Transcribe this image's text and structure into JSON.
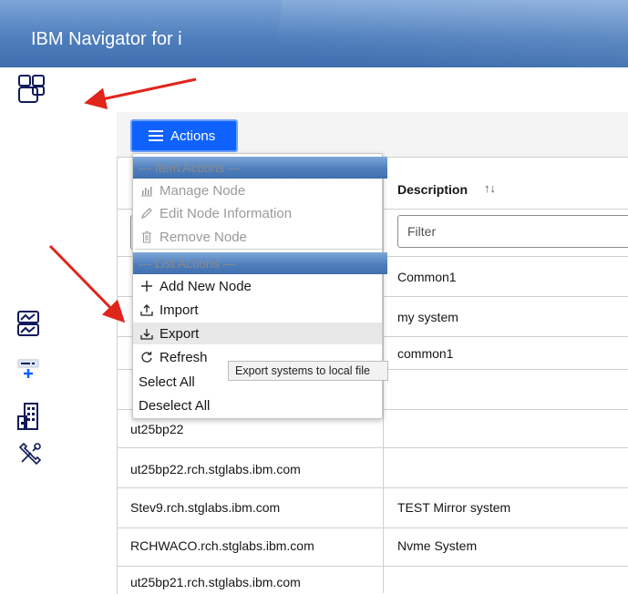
{
  "app": {
    "title": "IBM Navigator for i"
  },
  "toolbar": {
    "actions_label": "Actions"
  },
  "menu": {
    "item_actions_header": "--- Item Actions ---",
    "manage_node": "Manage Node",
    "edit_node_information": "Edit Node Information",
    "remove_node": "Remove Node",
    "list_actions_header": "--- List Actions ---",
    "add_new_node": "Add New Node",
    "import": "Import",
    "export": "Export",
    "refresh": "Refresh",
    "select_all": "Select All",
    "deselect_all": "Deselect All"
  },
  "tooltip": {
    "export": "Export systems to local file"
  },
  "table": {
    "description_header": "Description",
    "filter_placeholder": "Filter",
    "rows": [
      {
        "name": "",
        "description": "Common1"
      },
      {
        "name": "",
        "description": "my system"
      },
      {
        "name": "",
        "description": "common1"
      },
      {
        "name": "",
        "description": ""
      },
      {
        "name": "ut25bp22",
        "description": ""
      },
      {
        "name": "ut25bp22.rch.stglabs.ibm.com",
        "description": ""
      },
      {
        "name": "Stev9.rch.stglabs.ibm.com",
        "description": "TEST Mirror system"
      },
      {
        "name": "RCHWACO.rch.stglabs.ibm.com",
        "description": "Nvme System"
      },
      {
        "name": "ut25bp21.rch.stglabs.ibm.com",
        "description": ""
      }
    ]
  },
  "colors": {
    "header_blue": "#4f7fbd",
    "primary_button": "#0f62fe",
    "annotation_red": "#e0251b"
  },
  "icons": [
    "workspaces-icon",
    "monitor-chart-icon",
    "add-system-icon",
    "building-icon",
    "tools-icon"
  ]
}
